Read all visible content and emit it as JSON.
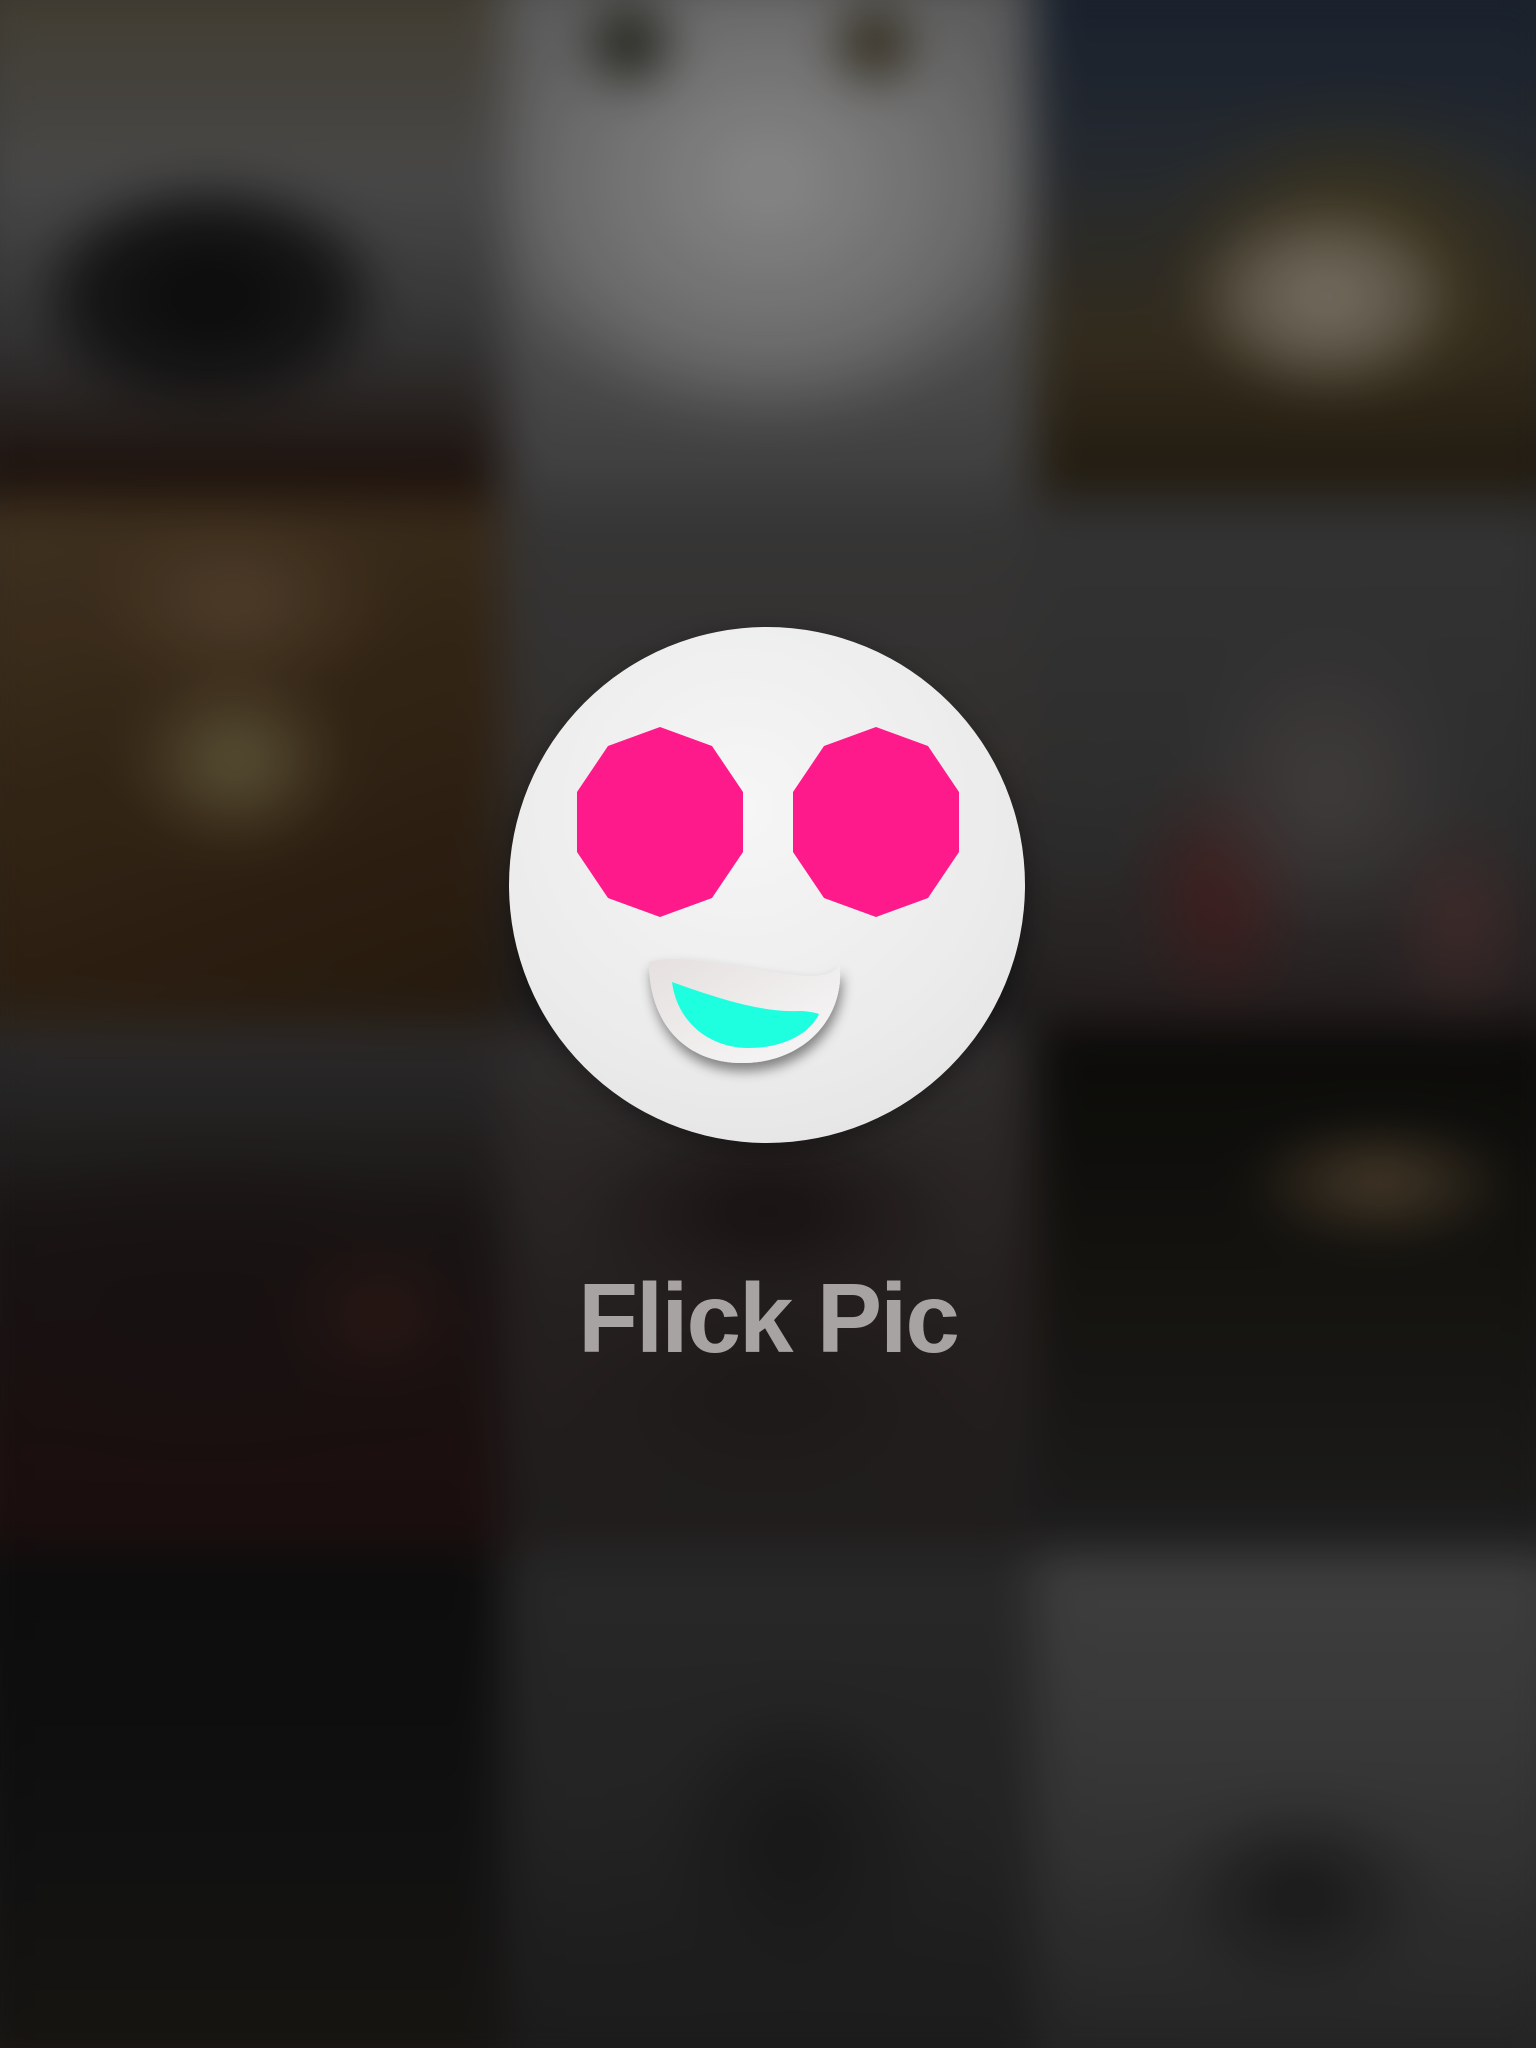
{
  "app": {
    "title": "Flick Pic"
  },
  "logo": {
    "icon": "smiley-face-logo-icon",
    "eye_color": "#ff1a8c",
    "mouth_color": "#1effe0",
    "face_color": "#f0f0f0"
  },
  "background": {
    "type": "blurred-photo-grid",
    "columns": 3,
    "rows": 4
  }
}
